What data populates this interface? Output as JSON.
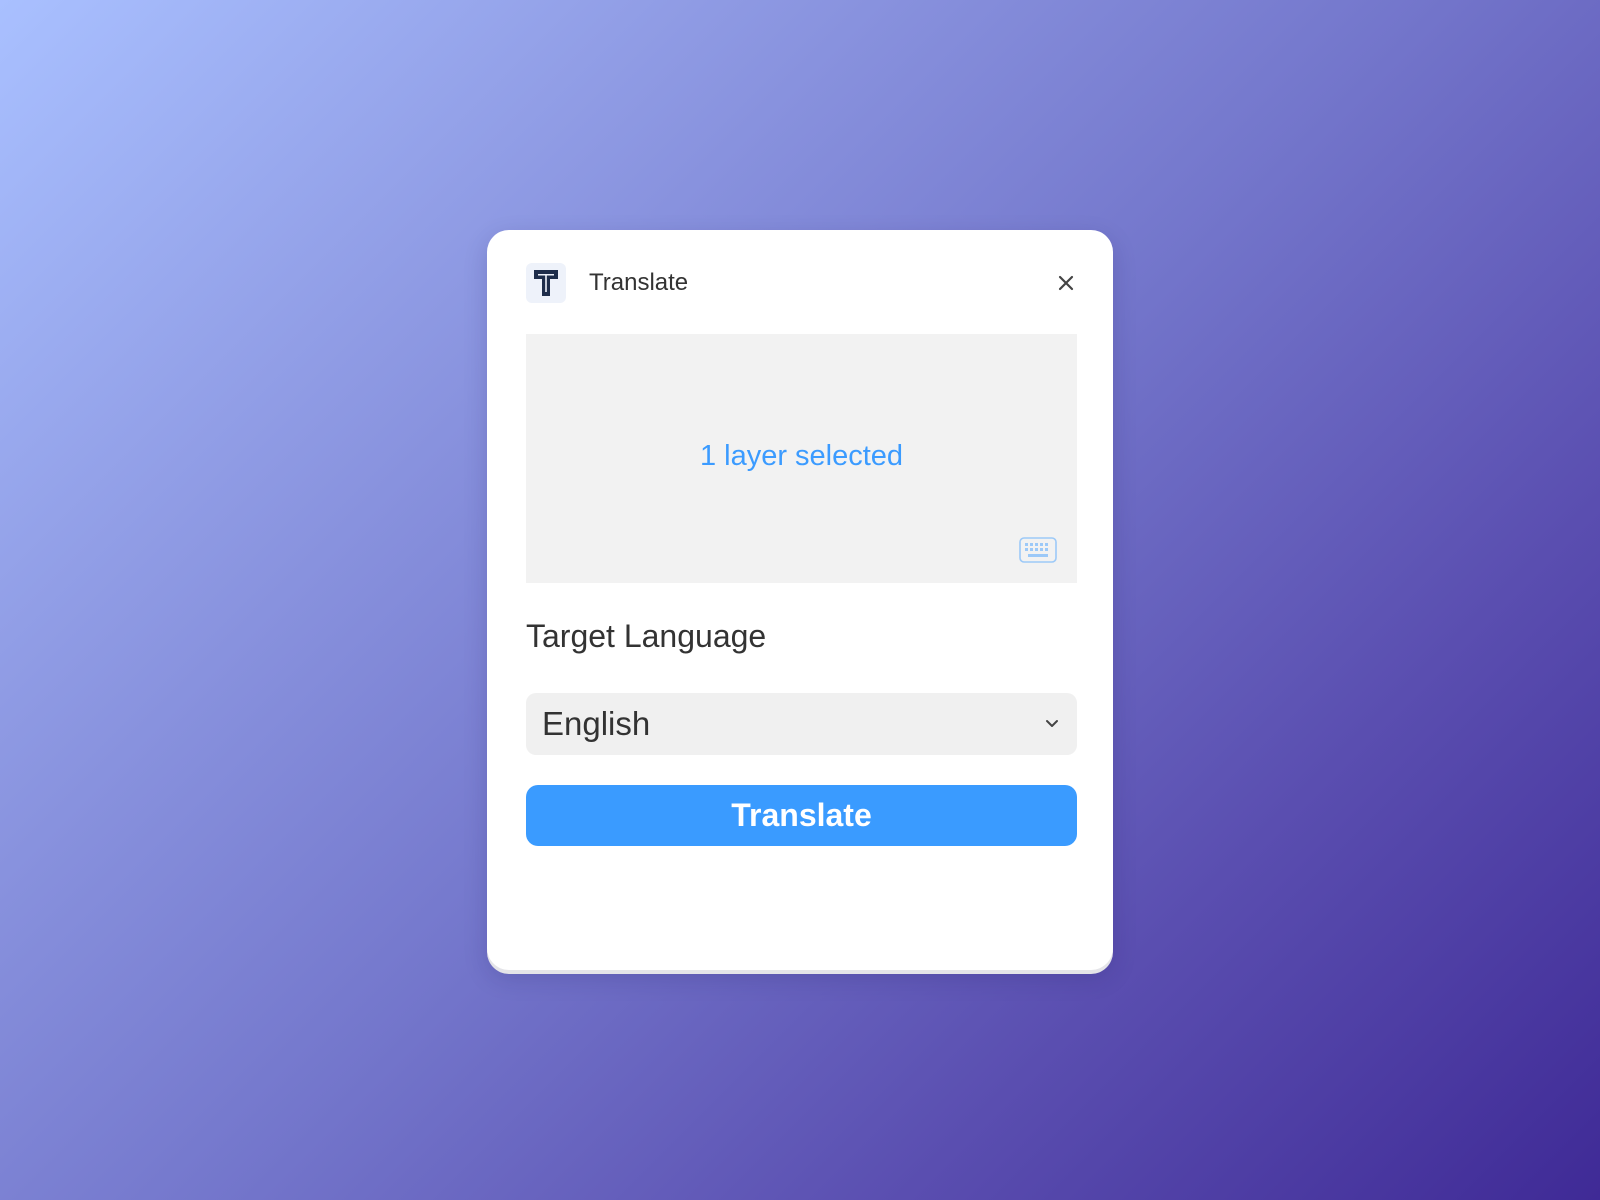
{
  "header": {
    "logo_icon": "translate-t-logo",
    "title": "Translate",
    "close_icon": "close-x"
  },
  "selection": {
    "status_text": "1 layer selected",
    "keyboard_icon": "keyboard"
  },
  "target_language": {
    "label": "Target Language",
    "selected_value": "English",
    "dropdown_icon": "chevron-down"
  },
  "actions": {
    "translate_label": "Translate"
  },
  "colors": {
    "accent": "#3a9bff",
    "selection_text": "#3b9bff",
    "panel_bg": "#ffffff",
    "input_bg": "#f0f0f0"
  }
}
